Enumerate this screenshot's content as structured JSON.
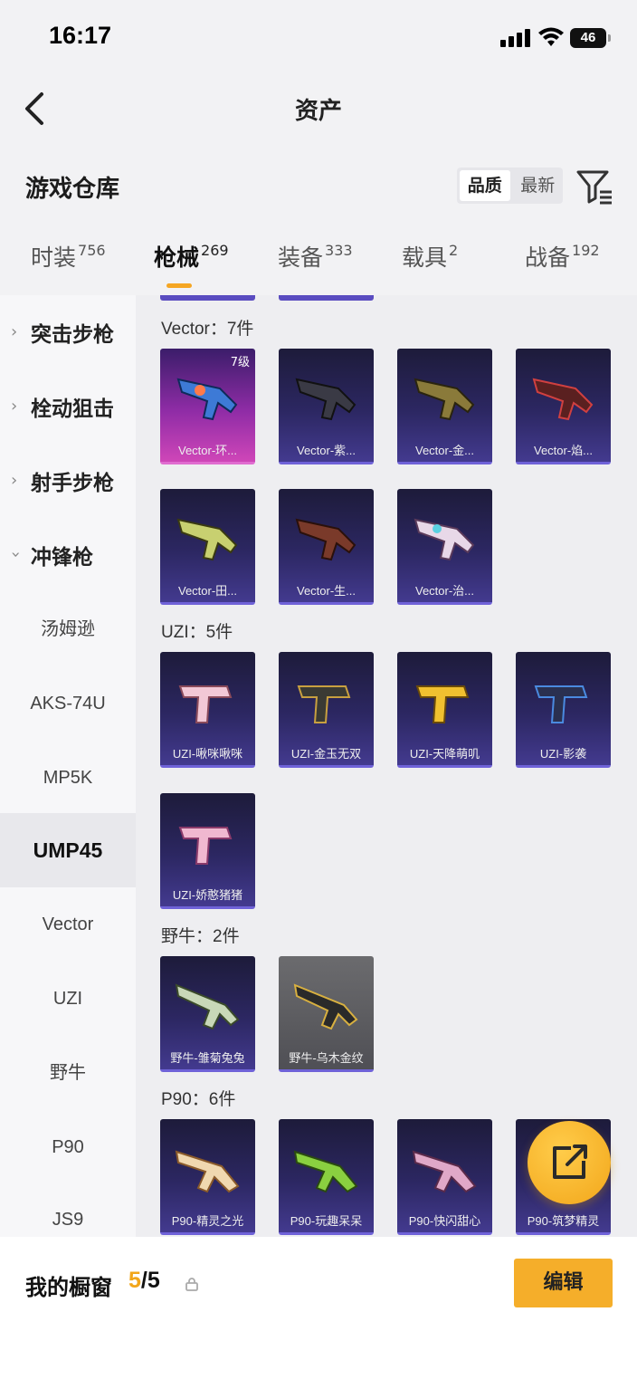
{
  "status": {
    "time": "16:17",
    "battery": "46"
  },
  "header": {
    "title": "资产"
  },
  "warehouse": {
    "title": "游戏仓库",
    "sort": [
      "品质",
      "最新"
    ]
  },
  "tabs": [
    {
      "label": "时装",
      "count": "756"
    },
    {
      "label": "枪械",
      "count": "269"
    },
    {
      "label": "装备",
      "count": "333"
    },
    {
      "label": "载具",
      "count": "2"
    },
    {
      "label": "战备",
      "count": "192"
    }
  ],
  "sidebar": {
    "categories": [
      "突击步枪",
      "栓动狙击",
      "射手步枪",
      "冲锋枪"
    ],
    "subs": [
      "汤姆逊",
      "AKS-74U",
      "MP5K",
      "UMP45",
      "Vector",
      "UZI",
      "野牛",
      "P90",
      "JS9"
    ]
  },
  "groups": [
    {
      "title": "Vector：7件",
      "items": [
        "Vector-环...",
        "Vector-紫...",
        "Vector-金...",
        "Vector-焰...",
        "Vector-田...",
        "Vector-生...",
        "Vector-治..."
      ],
      "first_item_level": "7级"
    },
    {
      "title": "UZI：5件",
      "items": [
        "UZI-啾咪啾咪",
        "UZI-金玉无双",
        "UZI-天降萌叽",
        "UZI-影袭",
        "UZI-娇憨猪猪"
      ]
    },
    {
      "title": "野牛：2件",
      "items": [
        "野牛-雏菊兔兔",
        "野牛-乌木金纹"
      ]
    },
    {
      "title": "P90：6件",
      "items": [
        "P90-精灵之光",
        "P90-玩趣呆呆",
        "P90-快闪甜心",
        "P90-筑梦精灵"
      ]
    }
  ],
  "bottom": {
    "label": "我的橱窗",
    "current": "5",
    "total": "/5",
    "edit": "编辑"
  },
  "colors": {
    "accent": "#f5a623",
    "card_purple": "#2c2762",
    "card_pink": "#cf46b8"
  }
}
